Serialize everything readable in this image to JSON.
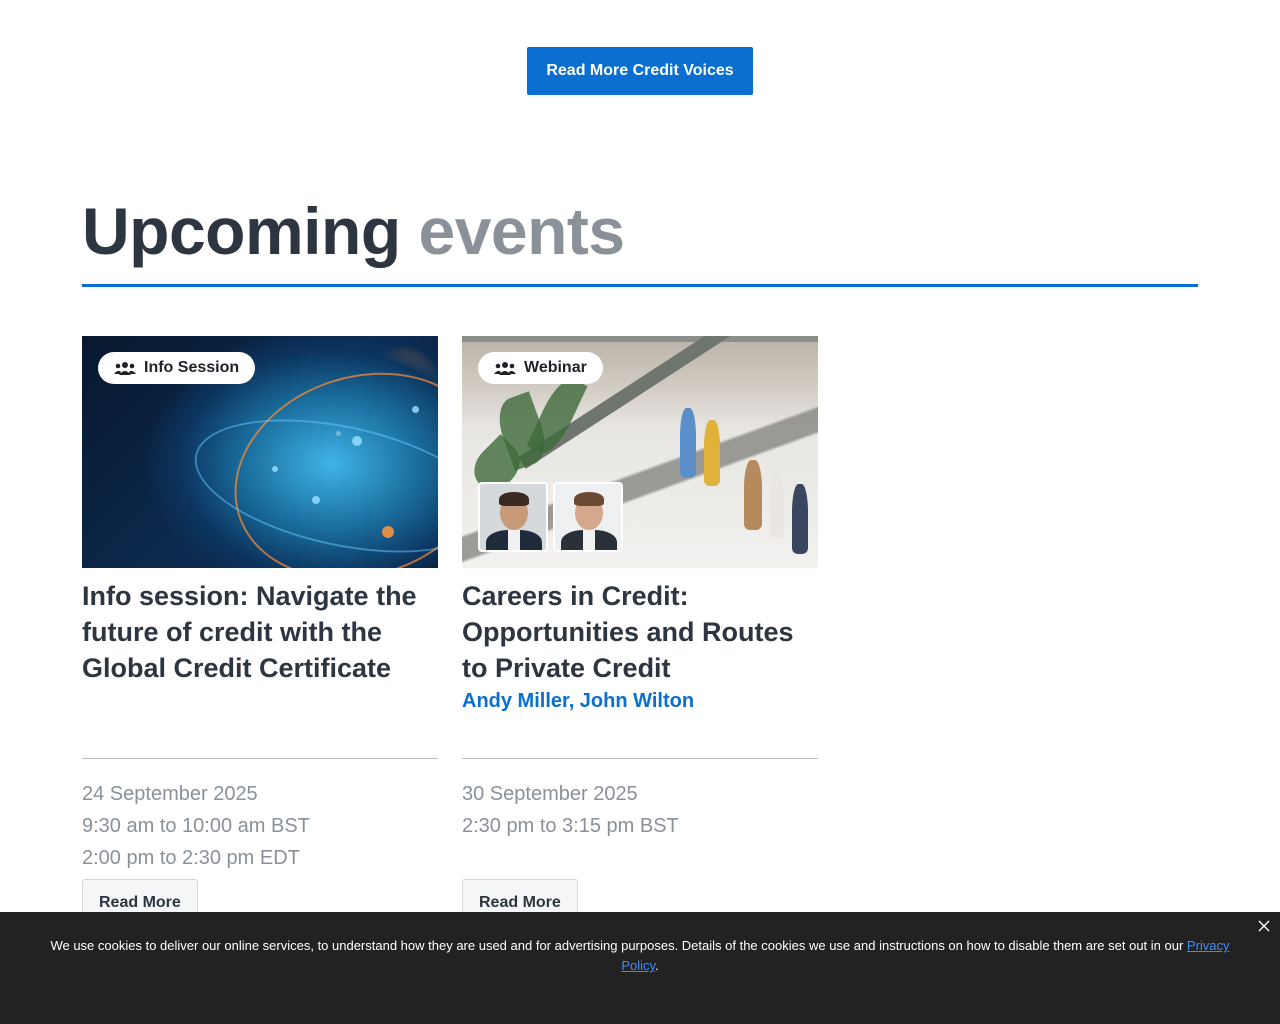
{
  "top_cta": {
    "label": "Read More Credit Voices"
  },
  "section": {
    "heading_primary": "Upcoming",
    "heading_secondary": "events"
  },
  "events": [
    {
      "badge": "Info Session",
      "badge_icon": "people-group-icon",
      "title": "Info session: Navigate the future of credit with the Global Credit Certificate",
      "authors": "",
      "date": "24 September 2025",
      "times": [
        "9:30 am to 10:00 am BST",
        "2:00 pm to 2:30 pm EDT"
      ],
      "read_more": "Read More"
    },
    {
      "badge": "Webinar",
      "badge_icon": "people-group-icon",
      "title": "Careers in Credit: Opportunities and Routes to Private Credit",
      "authors": "Andy Miller, John Wilton",
      "date": "30 September 2025",
      "times": [
        "2:30 pm to 3:15 pm BST"
      ],
      "read_more": "Read More"
    }
  ],
  "cookie_banner": {
    "text": "We use cookies to deliver our online services, to understand how they are used and for advertising purposes. Details of the cookies we use and instructions on how to disable them are set out in our ",
    "link_label": "Privacy Policy",
    "suffix": ".",
    "close_icon": "close-icon"
  },
  "colors": {
    "accent": "#0a6fd0",
    "heading_dark": "#2d3640",
    "heading_muted": "#8a9199",
    "banner_bg": "#222222"
  }
}
